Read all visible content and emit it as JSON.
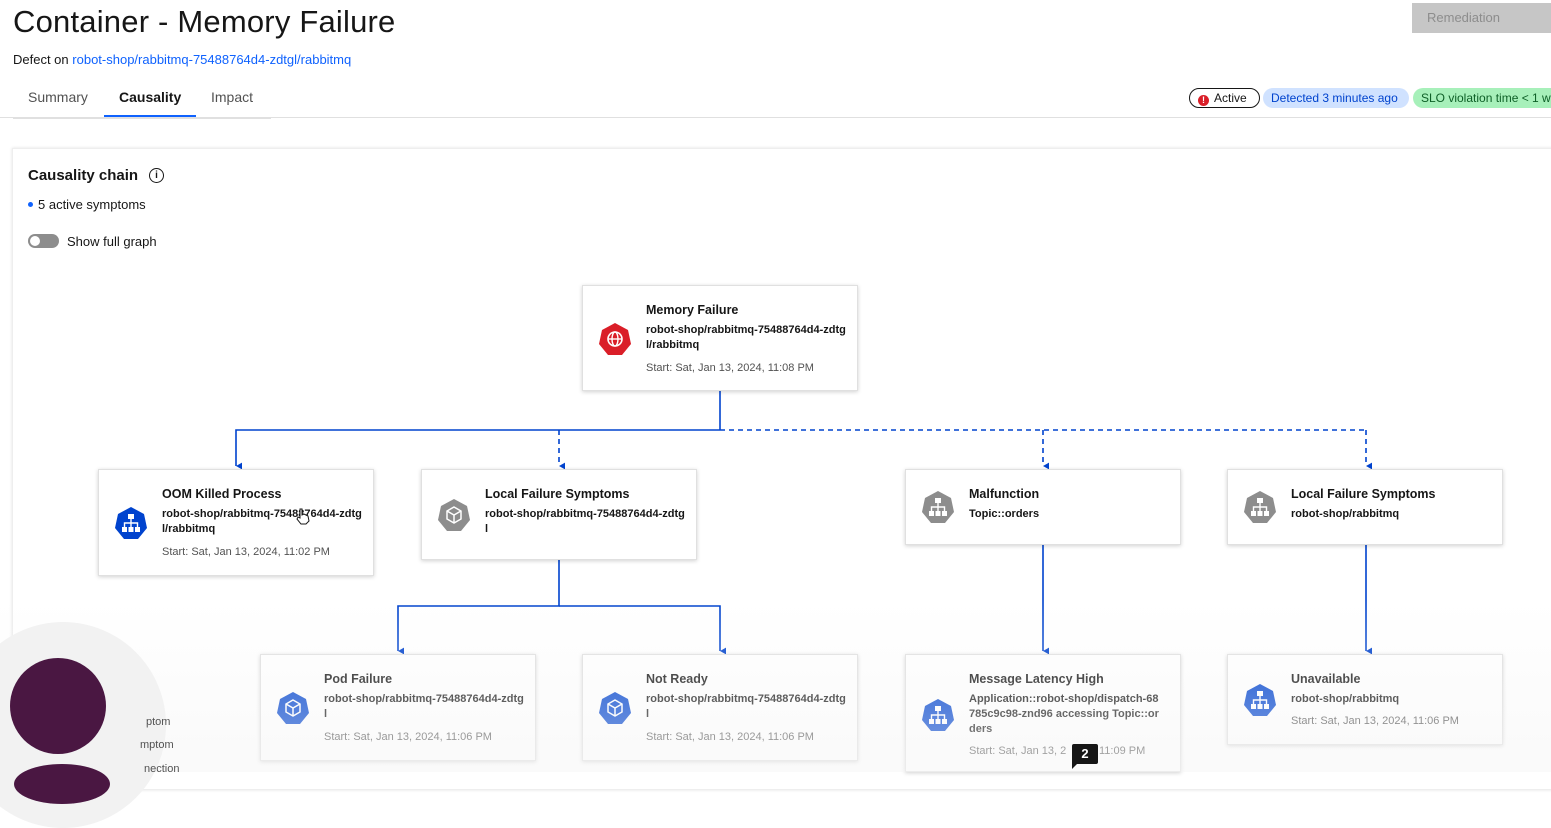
{
  "header": {
    "title": "Container - Memory Failure",
    "defect_prefix": "Defect on",
    "defect_link": "robot-shop/rabbitmq-75488764d4-zdtgl/rabbitmq",
    "remediation_label": "Remediation"
  },
  "tabs": [
    {
      "label": "Summary"
    },
    {
      "label": "Causality"
    },
    {
      "label": "Impact"
    }
  ],
  "tags": {
    "active_icon": "!",
    "active": "Active",
    "detected": "Detected 3 minutes ago",
    "slo": "SLO violation time < 1 w"
  },
  "causality": {
    "title": "Causality chain",
    "info_icon": "i",
    "active_symptoms": "5 active symptoms",
    "toggle_label": "Show full graph"
  },
  "nodes": {
    "root": {
      "title": "Memory Failure",
      "resource": "robot-shop/rabbitmq-75488764d4-zdtgl/rabbitmq",
      "start": "Start: Sat, Jan 13, 2024, 11:08 PM",
      "icon": "globe-icon",
      "color": "#da1e28"
    },
    "oom": {
      "title": "OOM Killed Process",
      "resource": "robot-shop/rabbitmq-75488764d4-zdtgl/rabbitmq",
      "start": "Start: Sat, Jan 13, 2024, 11:02 PM",
      "icon": "network-icon",
      "color": "#0043ce"
    },
    "local1": {
      "title": "Local Failure Symptoms",
      "resource": "robot-shop/rabbitmq-75488764d4-zdtgl",
      "start": "",
      "icon": "cube-icon",
      "color": "#8d8d8d"
    },
    "malfunction": {
      "title": "Malfunction",
      "resource": "Topic::orders",
      "start": "",
      "icon": "network-icon",
      "color": "#8d8d8d"
    },
    "local2": {
      "title": "Local Failure Symptoms",
      "resource": "robot-shop/rabbitmq",
      "start": "",
      "icon": "network-icon",
      "color": "#8d8d8d"
    },
    "pod": {
      "title": "Pod Failure",
      "resource": "robot-shop/rabbitmq-75488764d4-zdtgl",
      "start": "Start: Sat, Jan 13, 2024, 11:06 PM",
      "icon": "cube-icon",
      "color": "#0043ce"
    },
    "notready": {
      "title": "Not Ready",
      "resource": "robot-shop/rabbitmq-75488764d4-zdtgl",
      "start": "Start: Sat, Jan 13, 2024, 11:06 PM",
      "icon": "cube-icon",
      "color": "#0043ce"
    },
    "latency": {
      "title": "Message Latency High",
      "resource": "Application::robot-shop/dispatch-68785c9c98-znd96 accessing Topic::orders",
      "start": "Start: Sat, Jan 13, 2",
      "start_tail": "11:09 PM",
      "icon": "network-icon",
      "color": "#0043ce"
    },
    "unavailable": {
      "title": "Unavailable",
      "resource": "robot-shop/rabbitmq",
      "start": "Start: Sat, Jan 13, 2024, 11:06 PM",
      "icon": "network-icon",
      "color": "#0043ce"
    }
  },
  "legend_fragments": [
    "ptom",
    "mptom",
    "nection"
  ],
  "overlay_badge": "2"
}
